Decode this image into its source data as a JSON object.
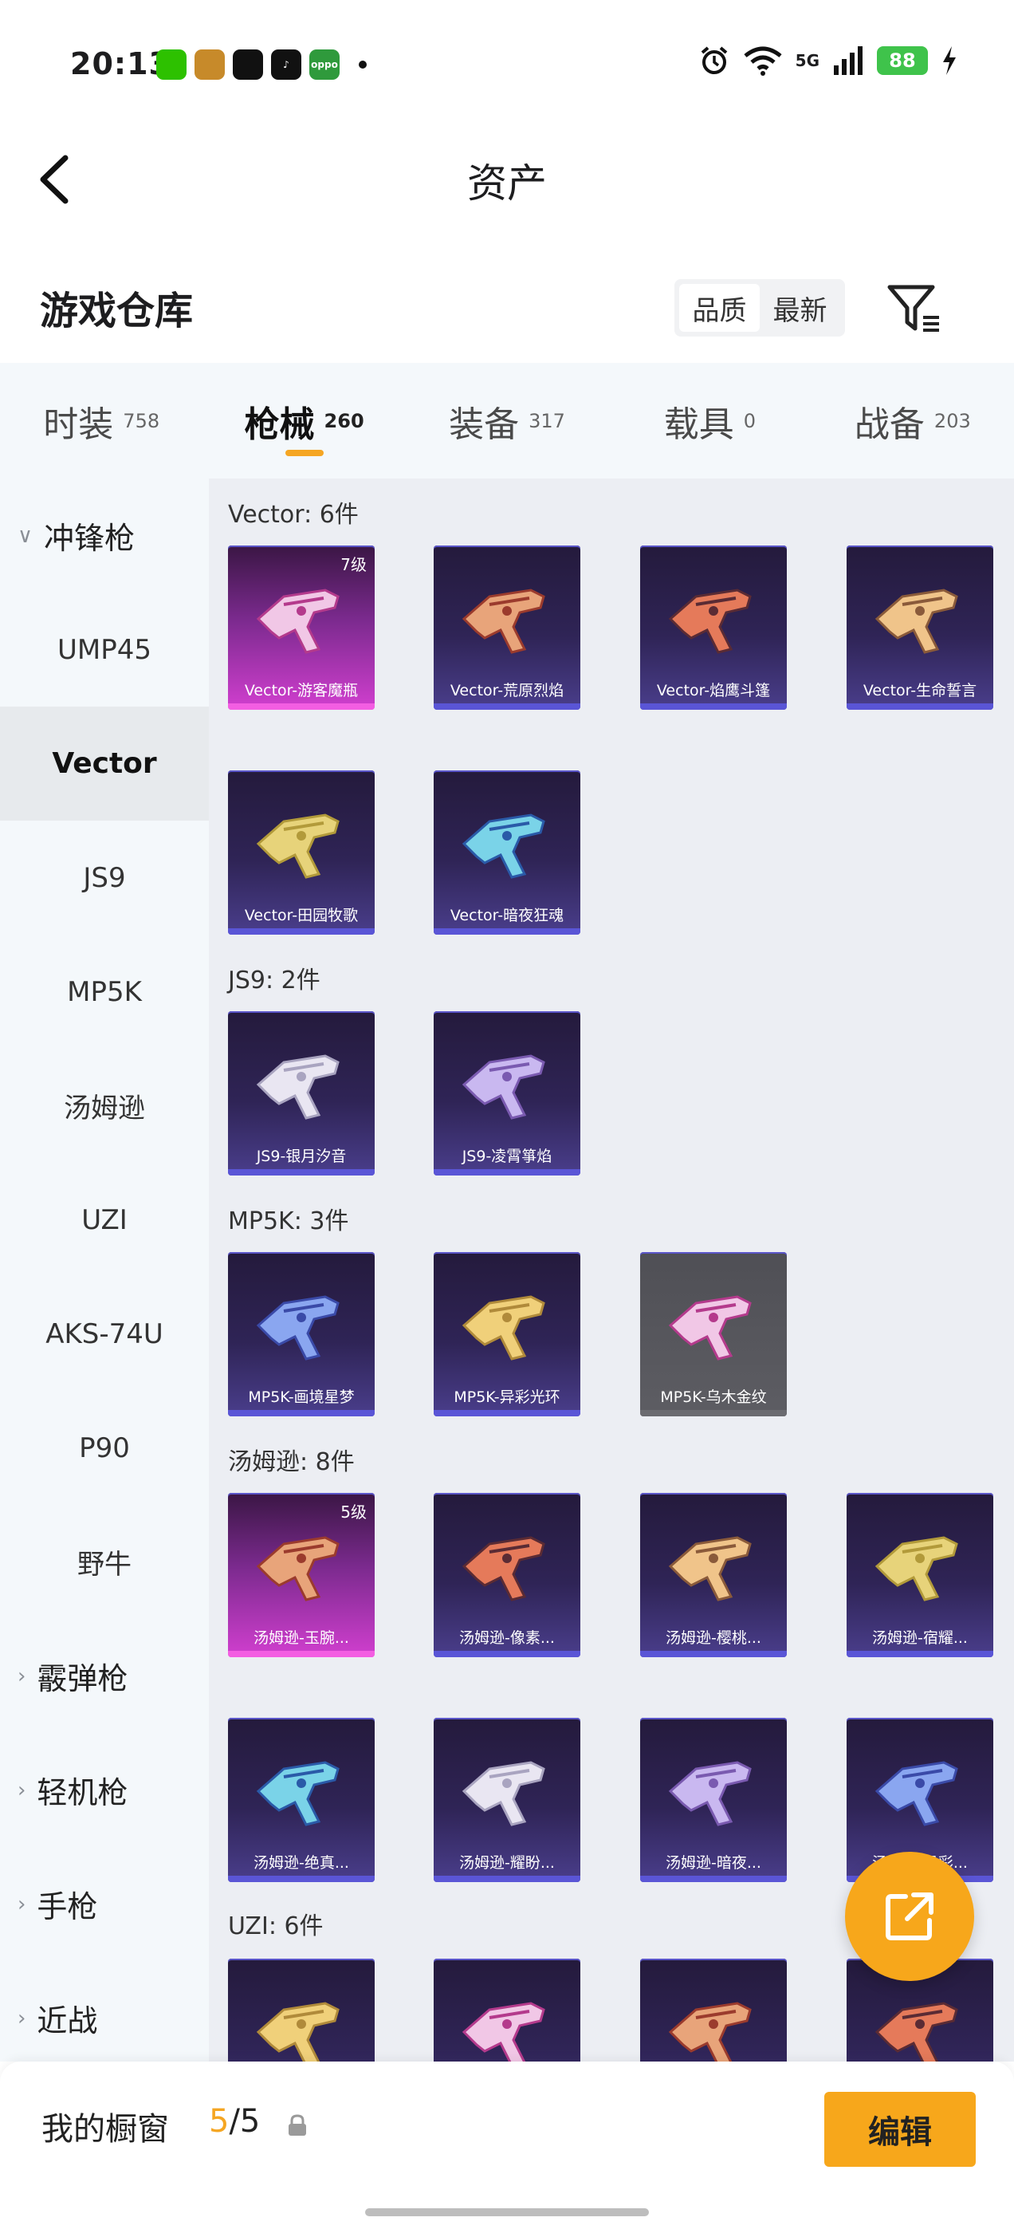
{
  "status_bar": {
    "time": "20:13",
    "apps": [
      {
        "icon": "wechat-icon",
        "color": "#2dc100",
        "text": ""
      },
      {
        "icon": "game-app-icon",
        "color": "#c78a2a",
        "text": ""
      },
      {
        "icon": "green-circle-app-icon",
        "color": "#111111",
        "text": ""
      },
      {
        "icon": "tiktok-icon",
        "color": "#111111",
        "text": "♪"
      },
      {
        "icon": "oppo-app-icon",
        "color": "#2f9a3c",
        "text": "oppo"
      }
    ],
    "network": "5G",
    "battery": "88"
  },
  "nav": {
    "title": "资产"
  },
  "warehouse": {
    "title": "游戏仓库",
    "sort_options": [
      "品质",
      "最新"
    ],
    "active_sort": 0
  },
  "tabs": [
    {
      "label": "时装",
      "count": "758"
    },
    {
      "label": "枪械",
      "count": "260",
      "active": true
    },
    {
      "label": "装备",
      "count": "317"
    },
    {
      "label": "载具",
      "count": "0"
    },
    {
      "label": "战备",
      "count": "203"
    }
  ],
  "sidebar": {
    "items": [
      {
        "label": "冲锋枪",
        "type": "group",
        "expanded": true
      },
      {
        "label": "UMP45",
        "type": "item"
      },
      {
        "label": "Vector",
        "type": "item",
        "active": true
      },
      {
        "label": "JS9",
        "type": "item"
      },
      {
        "label": "MP5K",
        "type": "item"
      },
      {
        "label": "汤姆逊",
        "type": "item"
      },
      {
        "label": "UZI",
        "type": "item"
      },
      {
        "label": "AKS-74U",
        "type": "item"
      },
      {
        "label": "P90",
        "type": "item"
      },
      {
        "label": "野牛",
        "type": "item"
      },
      {
        "label": "霰弹枪",
        "type": "group"
      },
      {
        "label": "轻机枪",
        "type": "group"
      },
      {
        "label": "手枪",
        "type": "group"
      },
      {
        "label": "近战",
        "type": "group"
      }
    ]
  },
  "sections": [
    {
      "label": "Vector: 6件",
      "cards": [
        {
          "name": "Vector-游客魔瓶",
          "level": "7级",
          "style": "pink"
        },
        {
          "name": "Vector-荒原烈焰",
          "style": "dark"
        },
        {
          "name": "Vector-焰鹰斗篷",
          "style": "dark"
        },
        {
          "name": "Vector-生命誓言",
          "style": "dark"
        },
        {
          "name": "Vector-田园牧歌",
          "style": "dark"
        },
        {
          "name": "Vector-暗夜狂魂",
          "style": "dark"
        }
      ]
    },
    {
      "label": "JS9: 2件",
      "cards": [
        {
          "name": "JS9-银月汐音",
          "style": "dark"
        },
        {
          "name": "JS9-凌霄箏焰",
          "style": "dark"
        }
      ]
    },
    {
      "label": "MP5K: 3件",
      "cards": [
        {
          "name": "MP5K-画境星梦",
          "style": "dark"
        },
        {
          "name": "MP5K-异彩光环",
          "style": "dark"
        },
        {
          "name": "MP5K-乌木金纹",
          "style": "grey"
        }
      ]
    },
    {
      "label": "汤姆逊: 8件",
      "cards": [
        {
          "name": "汤姆逊-玉腕...",
          "level": "5级",
          "style": "pink"
        },
        {
          "name": "汤姆逊-像素...",
          "style": "dark"
        },
        {
          "name": "汤姆逊-樱桃...",
          "style": "dark"
        },
        {
          "name": "汤姆逊-宿耀...",
          "style": "dark"
        },
        {
          "name": "汤姆逊-绝真...",
          "style": "dark"
        },
        {
          "name": "汤姆逊-耀盼...",
          "style": "dark"
        },
        {
          "name": "汤姆逊-暗夜...",
          "style": "dark"
        },
        {
          "name": "汤姆逊-异彩...",
          "style": "dark"
        }
      ]
    },
    {
      "label": "UZI: 6件",
      "cards": [
        {
          "name": "",
          "style": "dark"
        },
        {
          "name": "",
          "style": "dark"
        },
        {
          "name": "",
          "style": "dark"
        },
        {
          "name": "",
          "style": "dark"
        }
      ]
    }
  ],
  "footer": {
    "label": "我的橱窗",
    "count_current": "5",
    "count_total": "/5",
    "edit_label": "编辑"
  },
  "colors": {
    "accent": "#f7a71b",
    "sidebar_bg": "#f4f8fb",
    "content_bg": "#eceef3"
  }
}
